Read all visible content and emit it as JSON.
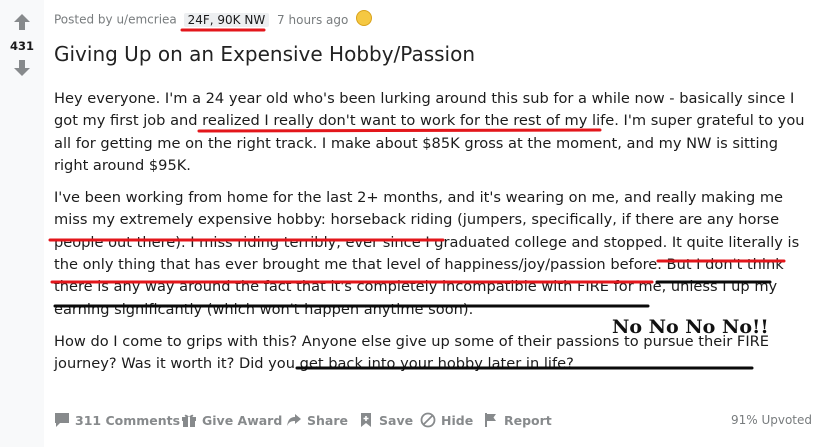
{
  "vote": {
    "score": "431"
  },
  "post": {
    "meta": {
      "posted_by": "Posted by u/emcriea",
      "flair": "24F, 90K NW",
      "time": "7 hours ago"
    },
    "title": "Giving Up on an Expensive Hobby/Passion",
    "paragraphs": [
      "Hey everyone. I'm a 24 year old who's been lurking around this sub for a while now - basically since I got my first job and realized I really don't want to work for the rest of my life. I'm super grateful to you all for getting me on the right track. I make about $85K gross at the moment, and my NW is sitting right around $95K.",
      "I've been working from home for the last 2+ months, and it's wearing on me, and really making me miss my extremely expensive hobby: horseback riding (jumpers, specifically, if there are any horse people out there). I miss riding terribly, ever since I graduated college and stopped. It quite literally is the only thing that has ever brought me that level of happiness/joy/passion before. But I don't think there is any way around the fact that it's completely incompatible with FIRE for me, unless I up my earning significantly (which won't happen anytime soon).",
      "How do I come to grips with this? Anyone else give up some of their passions to pursue their FIRE journey? Was it worth it? Did you get back into your hobby later in life?"
    ]
  },
  "annotation": {
    "text": "No No No No!!"
  },
  "footer": {
    "comments": "311 Comments",
    "give_award": "Give Award",
    "share": "Share",
    "save": "Save",
    "hide": "Hide",
    "report": "Report",
    "upvoted": "91% Upvoted"
  },
  "colors": {
    "red_underline": "#e3161b",
    "black_underline": "#0a0a0a",
    "award_gold": "#f5c842"
  }
}
